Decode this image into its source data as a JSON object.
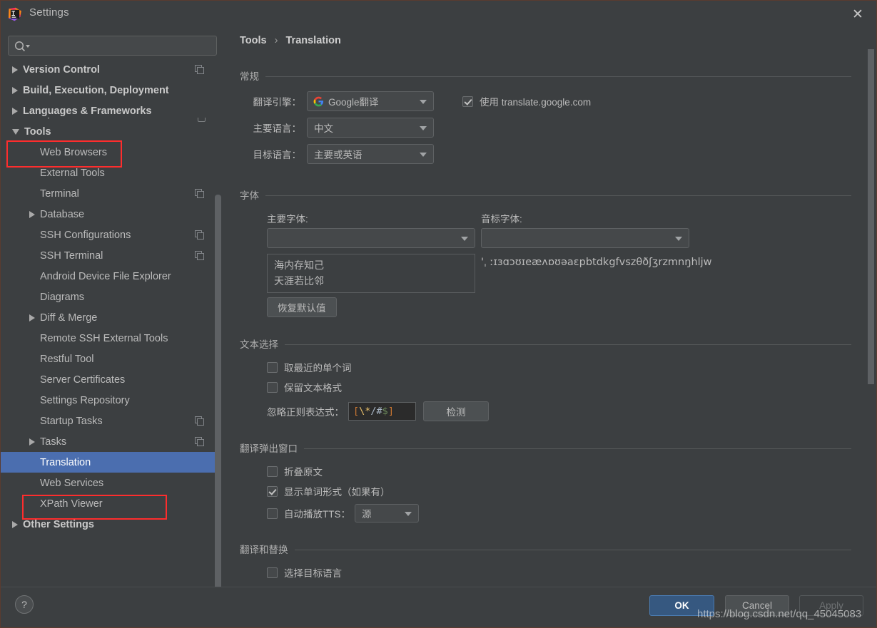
{
  "window": {
    "title": "Settings",
    "app_icon": "intellij-idea-logo",
    "close_icon": "close-icon"
  },
  "search": {
    "placeholder": "",
    "value": "",
    "icon": "search-icon"
  },
  "sidebar": {
    "items": [
      {
        "label": "Version Control",
        "indent": 0,
        "twisty": "collapsed",
        "bold": true,
        "badge": true,
        "selected": false
      },
      {
        "label": "Build, Execution, Deployment",
        "indent": 0,
        "twisty": "collapsed",
        "bold": true,
        "badge": false,
        "selected": false
      },
      {
        "label": "Languages & Frameworks",
        "indent": 0,
        "twisty": "collapsed",
        "bold": true,
        "badge": false,
        "selected": false
      },
      {
        "label": "Tools",
        "indent": 0,
        "twisty": "expanded",
        "bold": true,
        "badge": false,
        "selected": false
      },
      {
        "label": "Web Browsers",
        "indent": 1,
        "twisty": "none",
        "bold": false,
        "badge": false,
        "selected": false
      },
      {
        "label": "External Tools",
        "indent": 1,
        "twisty": "none",
        "bold": false,
        "badge": false,
        "selected": false
      },
      {
        "label": "Terminal",
        "indent": 1,
        "twisty": "none",
        "bold": false,
        "badge": true,
        "selected": false
      },
      {
        "label": "Database",
        "indent": 1,
        "twisty": "collapsed",
        "bold": false,
        "badge": false,
        "selected": false
      },
      {
        "label": "SSH Configurations",
        "indent": 1,
        "twisty": "none",
        "bold": false,
        "badge": true,
        "selected": false
      },
      {
        "label": "SSH Terminal",
        "indent": 1,
        "twisty": "none",
        "bold": false,
        "badge": true,
        "selected": false
      },
      {
        "label": "Android Device File Explorer",
        "indent": 1,
        "twisty": "none",
        "bold": false,
        "badge": false,
        "selected": false
      },
      {
        "label": "Diagrams",
        "indent": 1,
        "twisty": "none",
        "bold": false,
        "badge": false,
        "selected": false
      },
      {
        "label": "Diff & Merge",
        "indent": 1,
        "twisty": "collapsed",
        "bold": false,
        "badge": false,
        "selected": false
      },
      {
        "label": "Remote SSH External Tools",
        "indent": 1,
        "twisty": "none",
        "bold": false,
        "badge": false,
        "selected": false
      },
      {
        "label": "Restful Tool",
        "indent": 1,
        "twisty": "none",
        "bold": false,
        "badge": false,
        "selected": false
      },
      {
        "label": "Server Certificates",
        "indent": 1,
        "twisty": "none",
        "bold": false,
        "badge": false,
        "selected": false
      },
      {
        "label": "Settings Repository",
        "indent": 1,
        "twisty": "none",
        "bold": false,
        "badge": false,
        "selected": false
      },
      {
        "label": "Startup Tasks",
        "indent": 1,
        "twisty": "none",
        "bold": false,
        "badge": true,
        "selected": false
      },
      {
        "label": "Tasks",
        "indent": 1,
        "twisty": "collapsed",
        "bold": false,
        "badge": true,
        "selected": false
      },
      {
        "label": "Translation",
        "indent": 1,
        "twisty": "none",
        "bold": false,
        "badge": false,
        "selected": true
      },
      {
        "label": "Web Services",
        "indent": 1,
        "twisty": "none",
        "bold": false,
        "badge": false,
        "selected": false
      },
      {
        "label": "XPath Viewer",
        "indent": 1,
        "twisty": "none",
        "bold": false,
        "badge": false,
        "selected": false
      },
      {
        "label": "Other Settings",
        "indent": 0,
        "twisty": "collapsed",
        "bold": true,
        "badge": false,
        "selected": false
      }
    ]
  },
  "breadcrumb": {
    "parent": "Tools",
    "separator": "›",
    "current": "Translation"
  },
  "general": {
    "section_title": "常规",
    "engine_label": "翻译引擎：",
    "engine_value": "Google翻译",
    "engine_icon": "google-logo-icon",
    "use_google_checkbox": {
      "label": "使用 translate.google.com",
      "checked": true
    },
    "primary_lang_label": "主要语言：",
    "primary_lang_value": "中文",
    "target_lang_label": "目标语言：",
    "target_lang_value": "主要或英语"
  },
  "font": {
    "section_title": "字体",
    "primary_font_label": "主要字体:",
    "primary_font_value": "",
    "phonetic_font_label": "音标字体:",
    "phonetic_font_value": "",
    "preview_line1": "海内存知己",
    "preview_line2": "天涯若比邻",
    "phonetic_preview": "'ˌ ːɪɜɑɔʊɪeæʌɒʊəaɛpbtdkgfvszθðʃʒrzmnŋhljw",
    "restore_button": "恢复默认值"
  },
  "text_selection": {
    "section_title": "文本选择",
    "nearest_word_checkbox": {
      "label": "取最近的单个词",
      "checked": false
    },
    "keep_format_checkbox": {
      "label": "保留文本格式",
      "checked": false
    },
    "regex_label": "忽略正则表达式：",
    "regex_value": "[\\*/#$]",
    "regex_tokens": [
      {
        "t": "[",
        "c": "br"
      },
      {
        "t": "\\*",
        "c": "esc"
      },
      {
        "t": "/#",
        "c": "plain"
      },
      {
        "t": "$",
        "c": "dollar"
      },
      {
        "t": "]",
        "c": "br"
      }
    ],
    "detect_button": "检测"
  },
  "popup": {
    "section_title": "翻译弹出窗口",
    "fold_source_checkbox": {
      "label": "折叠原文",
      "checked": false
    },
    "show_word_forms_checkbox": {
      "label": "显示单词形式（如果有）",
      "checked": true
    },
    "auto_tts_checkbox": {
      "label": "自动播放TTS：",
      "checked": false
    },
    "tts_value": "源"
  },
  "translate_replace": {
    "section_title": "翻译和替换",
    "select_target_checkbox": {
      "label": "选择目标语言",
      "checked": false
    }
  },
  "footer": {
    "help_label": "?",
    "ok_label": "OK",
    "cancel_label": "Cancel",
    "apply_label": "Apply"
  },
  "watermark": "https://blog.csdn.net/qq_45045083",
  "colors": {
    "background": "#3c3f41",
    "selection": "#4b6eaf",
    "accent_ok": "#365880",
    "annotation": "#fe2d2d",
    "text": "#bbbbbb"
  }
}
